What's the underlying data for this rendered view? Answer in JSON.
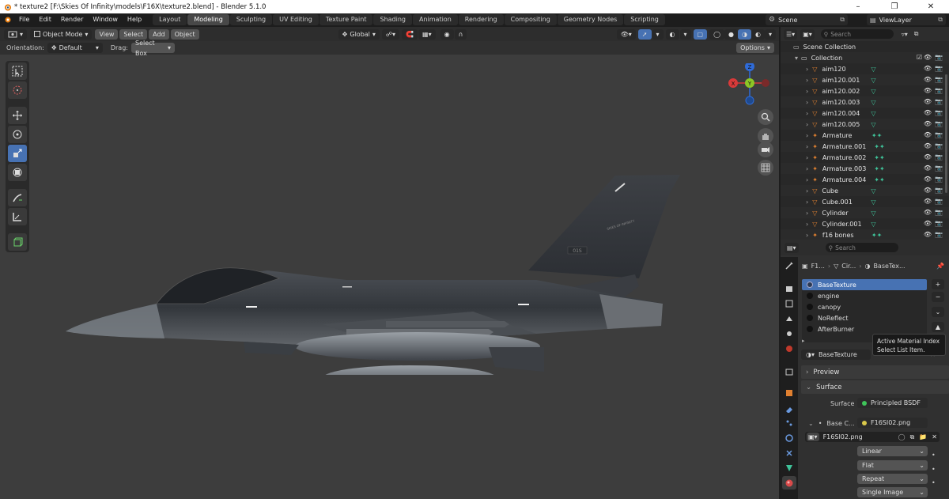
{
  "window": {
    "title": "* texture2 [F:\\Skies Of Infinity\\models\\F16X\\texture2.blend] - Blender 5.1.0",
    "min": "–",
    "max": "❐",
    "close": "✕"
  },
  "menus": [
    "File",
    "Edit",
    "Render",
    "Window",
    "Help"
  ],
  "workspaces": [
    "Layout",
    "Modeling",
    "Sculpting",
    "UV Editing",
    "Texture Paint",
    "Shading",
    "Animation",
    "Rendering",
    "Compositing",
    "Geometry Nodes",
    "Scripting"
  ],
  "active_workspace": "Modeling",
  "scene": "Scene",
  "view_layer": "ViewLayer",
  "viewport": {
    "mode": "Object Mode",
    "menu": [
      "View",
      "Select",
      "Add",
      "Object"
    ],
    "transform": "Global",
    "orientation_label": "Orientation:",
    "orientation": "Default",
    "drag_label": "Drag:",
    "drag": "Select Box",
    "options": "Options",
    "gizmo": {
      "z": "Z",
      "y": "Y",
      "x": "X"
    },
    "tail_text": "SKIES OF INFINITY",
    "tail_code": "01S"
  },
  "outliner": {
    "search": "Search",
    "scene_collection": "Scene Collection",
    "collection": "Collection",
    "items": [
      "aim120",
      "aim120.001",
      "aim120.002",
      "aim120.003",
      "aim120.004",
      "aim120.005",
      "Armature",
      "Armature.001",
      "Armature.002",
      "Armature.003",
      "Armature.004",
      "Cube",
      "Cube.001",
      "Cylinder",
      "Cylinder.001",
      "f16 bones"
    ]
  },
  "properties": {
    "search": "Search",
    "breadcrumb": [
      "F1...",
      "Cir...",
      "BaseTex..."
    ],
    "materials": [
      "BaseTexture",
      "engine",
      "canopy",
      "NoReflect",
      "AfterBurner"
    ],
    "active_material": "BaseTexture",
    "tooltip": {
      "title": "Active Material Index",
      "body": "Select List Item."
    },
    "preview": "Preview",
    "surface_section": "Surface",
    "surface_label": "Surface",
    "surface_value": "Principled BSDF",
    "base_color_label": "Base C...",
    "base_color_value": "F16SI02.png",
    "image_name": "F16SI02.png",
    "interpolation": "Linear",
    "projection": "Flat",
    "extension": "Repeat",
    "source": "Single Image"
  },
  "colors": {
    "accent": "#4772b3",
    "viewport_bg": "#3d3d3d",
    "panel_bg": "#303030"
  }
}
